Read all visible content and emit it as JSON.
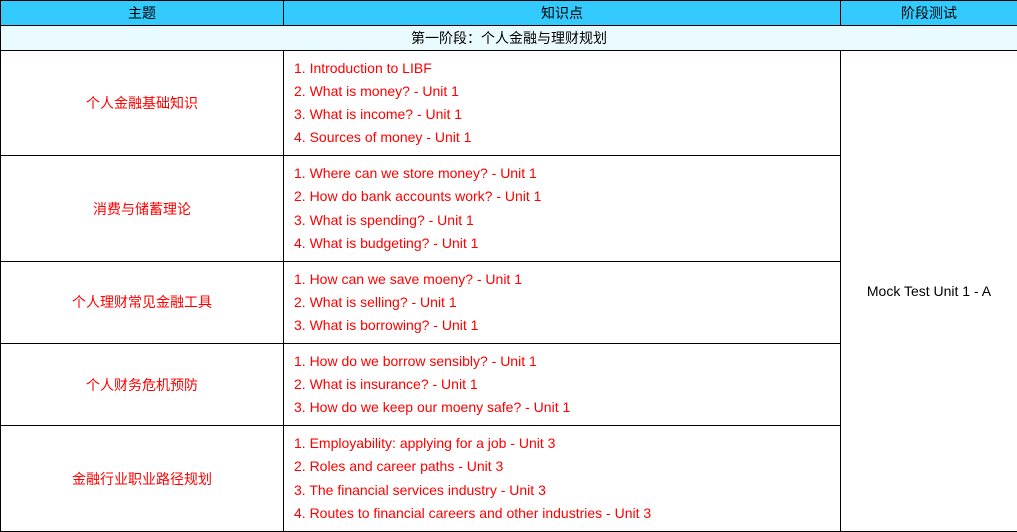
{
  "headers": {
    "topic": "主题",
    "knowledge": "知识点",
    "test": "阶段测试"
  },
  "stage_title": "第一阶段：个人金融与理财规划",
  "rows": [
    {
      "topic": "个人金融基础知识",
      "items": [
        "1. Introduction to LIBF",
        "2. What is money? - Unit 1",
        "3. What is income? - Unit 1",
        "4. Sources of money - Unit 1"
      ]
    },
    {
      "topic": "消费与储蓄理论",
      "items": [
        "1. Where can we store money? - Unit 1",
        "2. How do bank accounts work? - Unit 1",
        "3. What is spending? - Unit 1",
        "4. What is budgeting? - Unit 1"
      ]
    },
    {
      "topic": "个人理财常见金融工具",
      "items": [
        "1. How can we save moeny? - Unit 1",
        "2. What is selling? - Unit 1",
        "3. What is borrowing? - Unit 1"
      ]
    },
    {
      "topic": "个人财务危机预防",
      "items": [
        "1. How do we borrow sensibly? - Unit 1",
        "2. What is insurance? - Unit 1",
        "3. How do we keep our moeny safe? - Unit 1"
      ]
    },
    {
      "topic": "金融行业职业路径规划",
      "items": [
        "1. Employability: applying for a job - Unit 3",
        "2. Roles and career paths - Unit 3",
        "3. The financial services industry - Unit 3",
        "4. Routes to financial careers and other industries - Unit 3"
      ]
    }
  ],
  "test_label": "Mock Test Unit 1 - A"
}
